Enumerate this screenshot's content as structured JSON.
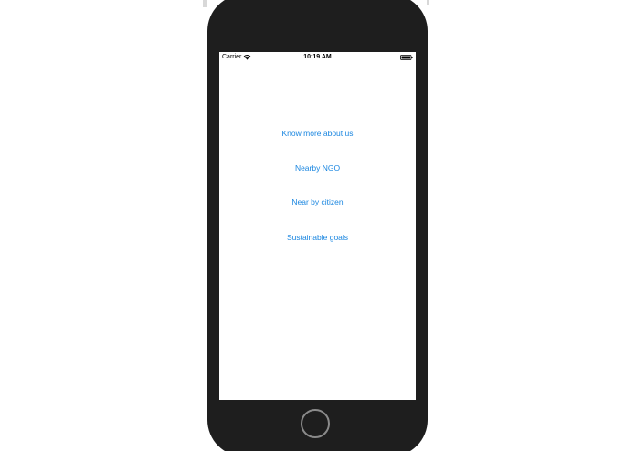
{
  "status_bar": {
    "carrier": "Carrier",
    "time": "10:19 AM",
    "icons": [
      "wifi-icon",
      "battery-icon"
    ]
  },
  "menu": {
    "items": [
      {
        "label": "Know more about us"
      },
      {
        "label": "Nearby NGO"
      },
      {
        "label": "Near by citizen"
      },
      {
        "label": "Sustainable goals"
      }
    ]
  },
  "colors": {
    "link": "#1a86e0",
    "device_frame": "#1e1e1e",
    "screen": "#ffffff"
  }
}
